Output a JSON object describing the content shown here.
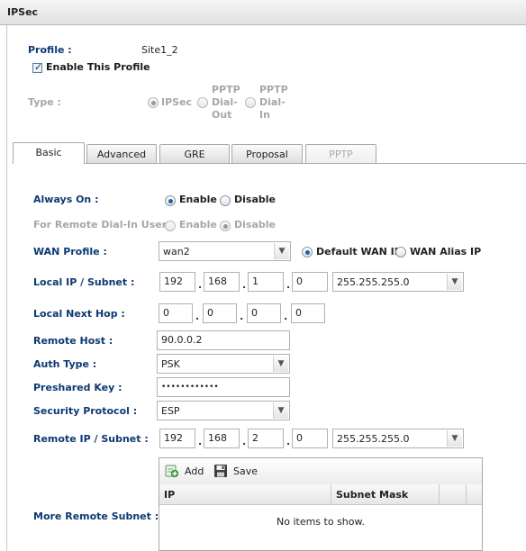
{
  "window": {
    "title": "IPSec"
  },
  "profile": {
    "label": "Profile :",
    "value": "Site1_2",
    "enable_label": "Enable This Profile",
    "enabled": true
  },
  "type": {
    "label": "Type :",
    "options": [
      {
        "label": "IPSec",
        "selected": true
      },
      {
        "label_lines": [
          "PPTP",
          "Dial-",
          "Out"
        ],
        "selected": false
      },
      {
        "label_lines": [
          "PPTP",
          "Dial-",
          "In"
        ],
        "selected": false
      }
    ]
  },
  "tabs": [
    {
      "label": "Basic",
      "active": true
    },
    {
      "label": "Advanced"
    },
    {
      "label": "GRE"
    },
    {
      "label": "Proposal"
    },
    {
      "label": "PPTP",
      "disabled": true
    }
  ],
  "basic": {
    "always_on": {
      "label": "Always On :",
      "enable": "Enable",
      "disable": "Disable",
      "selected": "Enable"
    },
    "remote_dialin": {
      "label": "For Remote Dial-In User :",
      "enable": "Enable",
      "disable": "Disable",
      "selected": "Disable"
    },
    "wan_profile": {
      "label": "WAN Profile :",
      "value": "wan2",
      "default_ip": "Default WAN IP",
      "alias_ip": "WAN Alias IP",
      "selected": "Default WAN IP"
    },
    "local_ip": {
      "label": "Local IP / Subnet :",
      "octets": [
        "192",
        "168",
        "1",
        "0"
      ],
      "mask": "255.255.255.0"
    },
    "local_next_hop": {
      "label": "Local Next Hop :",
      "octets": [
        "0",
        "0",
        "0",
        "0"
      ]
    },
    "remote_host": {
      "label": "Remote Host :",
      "value": "90.0.0.2"
    },
    "auth_type": {
      "label": "Auth Type :",
      "value": "PSK"
    },
    "preshared_key": {
      "label": "Preshared Key :",
      "value": "••••••••••••"
    },
    "security_protocol": {
      "label": "Security Protocol :",
      "value": "ESP"
    },
    "remote_ip": {
      "label": "Remote IP / Subnet :",
      "octets": [
        "192",
        "168",
        "2",
        "0"
      ],
      "mask": "255.255.255.0"
    },
    "more_remote_subnet": {
      "label": "More Remote Subnet :",
      "add": "Add",
      "save": "Save",
      "columns": [
        "IP",
        "Subnet Mask"
      ],
      "empty_text": "No items to show."
    }
  },
  "colors": {
    "label_blue": "#0d3a73",
    "radio_blue": "#1f5fa5",
    "add_green": "#3a9a3a"
  }
}
